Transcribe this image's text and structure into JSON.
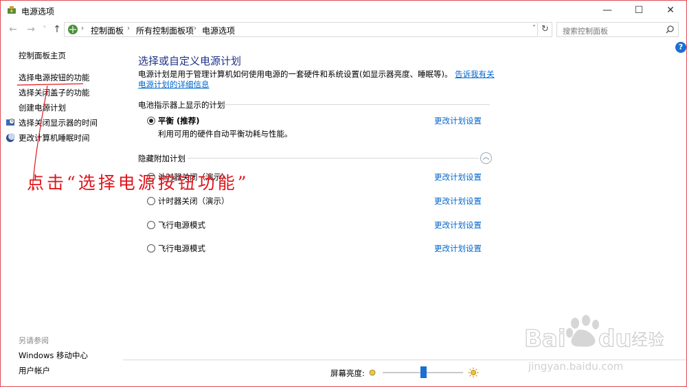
{
  "window": {
    "title": "电源选项"
  },
  "title_buttons": {
    "minimize": "—",
    "maximize": "☐",
    "close": "✕"
  },
  "nav": {
    "back": "←",
    "forward": "→",
    "history": "˅",
    "up": "↑"
  },
  "address": {
    "crumbs": [
      "控制面板",
      "所有控制面板项",
      "电源选项"
    ],
    "separator": "›",
    "dropdown": "˅",
    "refresh": "↻"
  },
  "search": {
    "placeholder": "搜索控制面板"
  },
  "help": "?",
  "sidebar": {
    "links": [
      "控制面板主页",
      "选择电源按钮的功能",
      "选择关闭盖子的功能",
      "创建电源计划",
      "选择关闭显示器的时间",
      "更改计算机睡眠时间"
    ],
    "see_also_title": "另请参阅",
    "see_also": [
      "Windows 移动中心",
      "用户帐户"
    ]
  },
  "main": {
    "title": "选择或自定义电源计划",
    "description": "电源计划是用于管理计算机如何使用电源的一套硬件和系统设置(如显示器亮度、睡眠等)。",
    "description_link": "告诉我有关电源计划的详细信息",
    "battery_section": "电池指示器上显示的计划",
    "selected_plan": {
      "name": "平衡 (推荐)",
      "desc": "利用可用的硬件自动平衡功耗与性能。",
      "change": "更改计划设置"
    },
    "hidden_section": "隐藏附加计划",
    "hidden_plans": [
      {
        "name": "计时器关闭（演示）",
        "change": "更改计划设置"
      },
      {
        "name": "计时器关闭（演示）",
        "change": "更改计划设置"
      },
      {
        "name": "飞行电源模式",
        "change": "更改计划设置"
      },
      {
        "name": "飞行电源模式",
        "change": "更改计划设置"
      }
    ]
  },
  "brightness": {
    "label": "屏幕亮度:",
    "level": 0.5
  },
  "annotation": {
    "text": "点击“选择电源按钮功能”",
    "color": "#e0161c"
  },
  "watermark": {
    "brand": "Bai du 经验",
    "url": "jingyan.baidu.com"
  },
  "colors": {
    "accent": "#0066cc",
    "title": "#1e3287",
    "window_border": "#e04a55",
    "slider": "#1a6fd1"
  }
}
